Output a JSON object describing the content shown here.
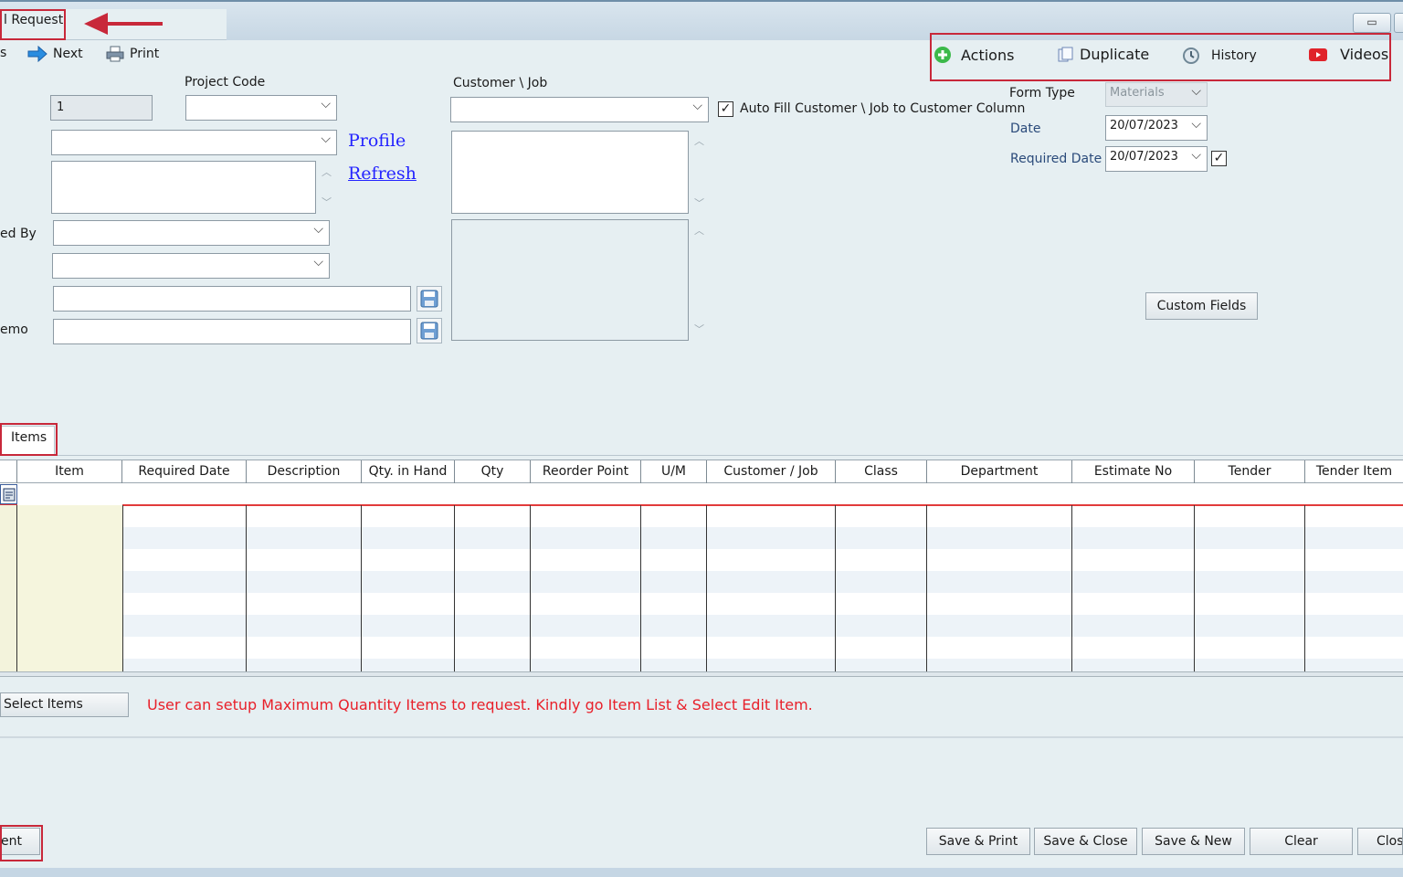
{
  "window": {
    "title": "l Request",
    "minimize_symbol": "▭"
  },
  "toolbar": {
    "prev_partial": "s",
    "next": "Next",
    "print": "Print"
  },
  "actions_bar": {
    "actions": "Actions",
    "duplicate": "Duplicate",
    "history": "History",
    "videos": "Videos"
  },
  "form": {
    "number_value": "1",
    "project_code_label": "Project Code",
    "customer_job_label": "Customer \\ Job",
    "auto_fill_label": "Auto Fill Customer \\ Job to Customer Column",
    "auto_fill_checked": "✓",
    "profile_link": "Profile",
    "refresh_link": "Refresh",
    "requested_by_partial": "ed By",
    "memo_partial": "emo",
    "form_type_label": "Form Type",
    "form_type_value": "Materials",
    "date_label": "Date",
    "date_value": "20/07/2023",
    "required_date_label": "Required Date",
    "required_date_value": "20/07/2023",
    "required_date_checked": "✓",
    "custom_fields": "Custom Fields"
  },
  "tabs": {
    "items": "Items"
  },
  "grid": {
    "columns": [
      "Item",
      "Required Date",
      "Description",
      "Qty. in Hand",
      "Qty",
      "Reorder Point",
      "U/M",
      "Customer / Job",
      "Class",
      "Department",
      "Estimate No",
      "Tender",
      "Tender Item"
    ]
  },
  "below_grid": {
    "select_items": "Select Items",
    "note": "User can setup Maximum Quantity  Items to request. Kindly go Item List & Select Edit Item."
  },
  "footer": {
    "left_partial": "ent",
    "save_print": "Save & Print",
    "save_close": "Save & Close",
    "save_new": "Save & New",
    "clear": "Clear",
    "close": "Close"
  }
}
